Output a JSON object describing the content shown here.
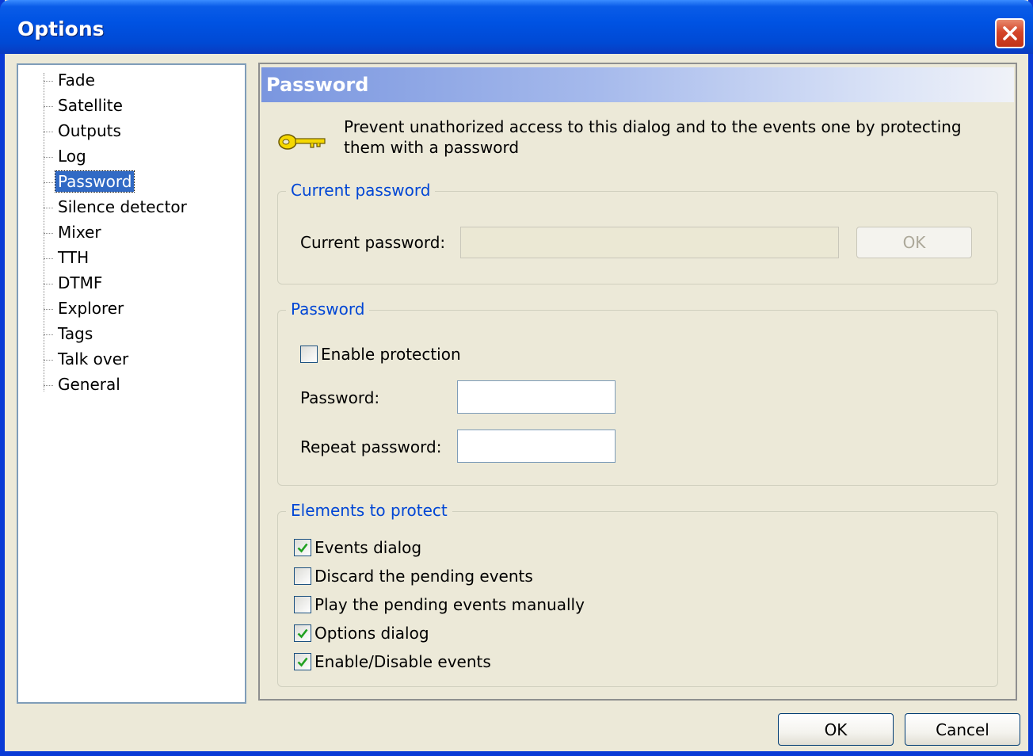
{
  "window": {
    "title": "Options"
  },
  "tree": {
    "items": [
      {
        "label": "Fade"
      },
      {
        "label": "Satellite"
      },
      {
        "label": "Outputs"
      },
      {
        "label": "Log"
      },
      {
        "label": "Password",
        "selected": true
      },
      {
        "label": "Silence detector"
      },
      {
        "label": "Mixer"
      },
      {
        "label": "TTH"
      },
      {
        "label": "DTMF"
      },
      {
        "label": "Explorer"
      },
      {
        "label": "Tags"
      },
      {
        "label": "Talk over"
      },
      {
        "label": "General"
      }
    ]
  },
  "panel": {
    "header": "Password",
    "icon": "key-icon",
    "description": "Prevent unathorized access to this dialog and to the events one by protecting them with a password"
  },
  "current_password_group": {
    "title": "Current password",
    "label": "Current password:",
    "value": "",
    "ok_label": "OK"
  },
  "password_group": {
    "title": "Password",
    "enable_label": "Enable protection",
    "enable_checked": false,
    "password_label": "Password:",
    "password_value": "",
    "repeat_label": "Repeat password:",
    "repeat_value": ""
  },
  "elements_group": {
    "title": "Elements to protect",
    "items": [
      {
        "label": "Events dialog",
        "checked": true
      },
      {
        "label": "Discard the pending events",
        "checked": false
      },
      {
        "label": "Play the pending events manually",
        "checked": false
      },
      {
        "label": "Options dialog",
        "checked": true
      },
      {
        "label": "Enable/Disable events",
        "checked": true
      }
    ]
  },
  "footer": {
    "ok_label": "OK",
    "cancel_label": "Cancel"
  },
  "colors": {
    "title_bar": "#0053e3",
    "selection": "#316ac5",
    "group_title": "#0046d5",
    "check_mark": "#21a121"
  }
}
